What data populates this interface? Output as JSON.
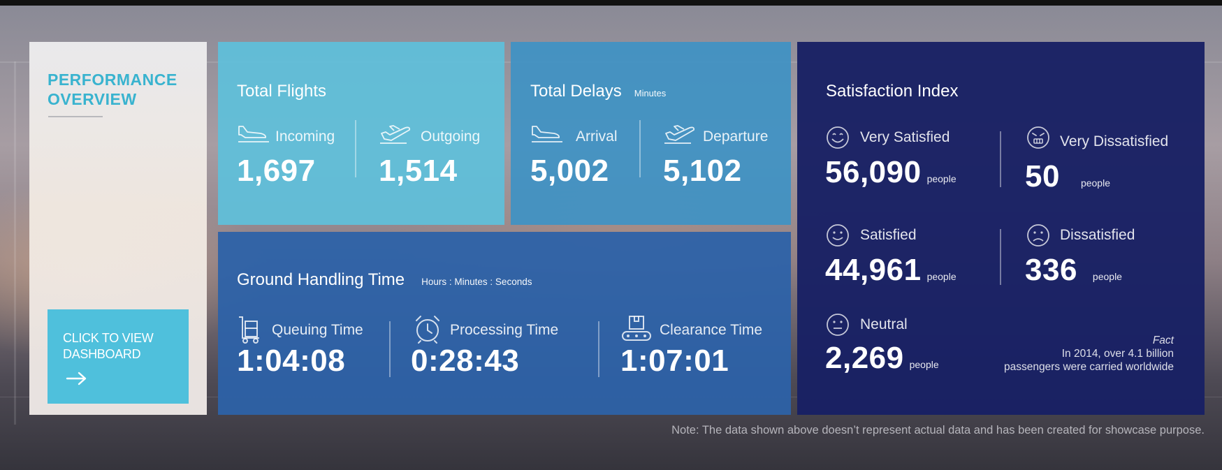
{
  "sidebar": {
    "title": "PERFORMANCE\nOVERVIEW",
    "cta_label": "CLICK TO VIEW\nDASHBOARD",
    "cta_icon": "arrow-right-icon"
  },
  "total_flights": {
    "title": "Total Flights",
    "incoming": {
      "label": "Incoming",
      "value": "1,697",
      "icon": "plane-landing-icon"
    },
    "outgoing": {
      "label": "Outgoing",
      "value": "1,514",
      "icon": "plane-takeoff-icon"
    }
  },
  "total_delays": {
    "title": "Total Delays",
    "subtitle": "Minutes",
    "arrival": {
      "label": "Arrival",
      "value": "5,002",
      "icon": "plane-landing-icon"
    },
    "departure": {
      "label": "Departure",
      "value": "5,102",
      "icon": "plane-takeoff-icon"
    }
  },
  "ground_handling": {
    "title": "Ground Handling Time",
    "subtitle": "Hours : Minutes : Seconds",
    "queuing": {
      "label": "Queuing Time",
      "value": "1:04:08",
      "icon": "luggage-cart-icon"
    },
    "processing": {
      "label": "Processing Time",
      "value": "0:28:43",
      "icon": "alarm-clock-icon"
    },
    "clearance": {
      "label": "Clearance Time",
      "value": "1:07:01",
      "icon": "conveyor-belt-icon"
    }
  },
  "satisfaction": {
    "title": "Satisfaction Index",
    "unit": "people",
    "very_satisfied": {
      "label": "Very Satisfied",
      "value": "56,090",
      "icon": "grin-face-icon"
    },
    "very_dissatisfied": {
      "label": "Very Dissatisfied",
      "value": "50",
      "icon": "angry-face-icon"
    },
    "satisfied": {
      "label": "Satisfied",
      "value": "44,961",
      "icon": "smile-face-icon"
    },
    "dissatisfied": {
      "label": "Dissatisfied",
      "value": "336",
      "icon": "frown-face-icon"
    },
    "neutral": {
      "label": "Neutral",
      "value": "2,269",
      "icon": "neutral-face-icon"
    },
    "fact_heading": "Fact",
    "fact_line1": "In 2014, over 4.1 billion",
    "fact_line2": "passengers were carried worldwide"
  },
  "footer_note": "Note: The data shown above doesn’t represent actual data and has been created for showcase purpose.",
  "colors": {
    "sidebar_accent": "#39b3cf",
    "cta": "#4fc0dc",
    "flights_panel": "#5fc0da",
    "delays_panel": "#4092c4",
    "ground_panel": "#2d62a8",
    "satisfaction_panel": "#182064"
  }
}
